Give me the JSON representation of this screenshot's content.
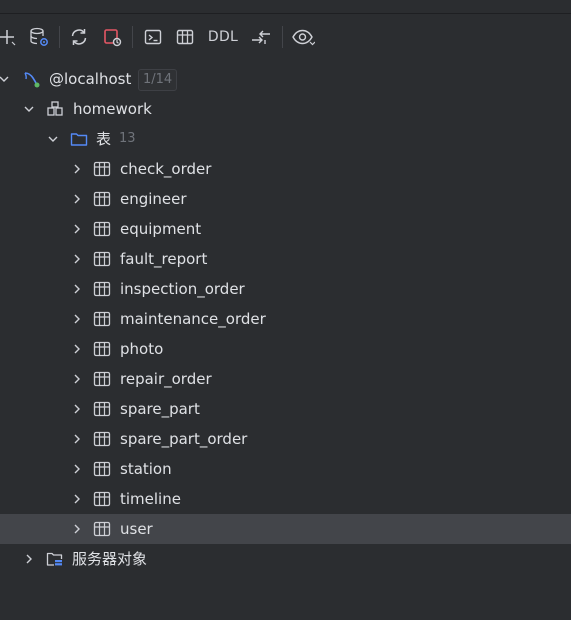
{
  "toolbar": {
    "ddl_label": "DDL"
  },
  "tree": {
    "connection": {
      "label": "@localhost",
      "badge": "1/14"
    },
    "schema": {
      "label": "homework"
    },
    "tables_folder": {
      "label": "表",
      "count": "13"
    },
    "tables": [
      "check_order",
      "engineer",
      "equipment",
      "fault_report",
      "inspection_order",
      "maintenance_order",
      "photo",
      "repair_order",
      "spare_part",
      "spare_part_order",
      "station",
      "timeline",
      "user"
    ],
    "server_objects": {
      "label": "服务器对象"
    }
  },
  "colors": {
    "background": "#2b2d30",
    "selected_row": "#43454a",
    "text": "#dfe1e5",
    "muted": "#6f737a",
    "accent_blue": "#548af7",
    "accent_red": "#e55765",
    "accent_green": "#5fb865"
  }
}
